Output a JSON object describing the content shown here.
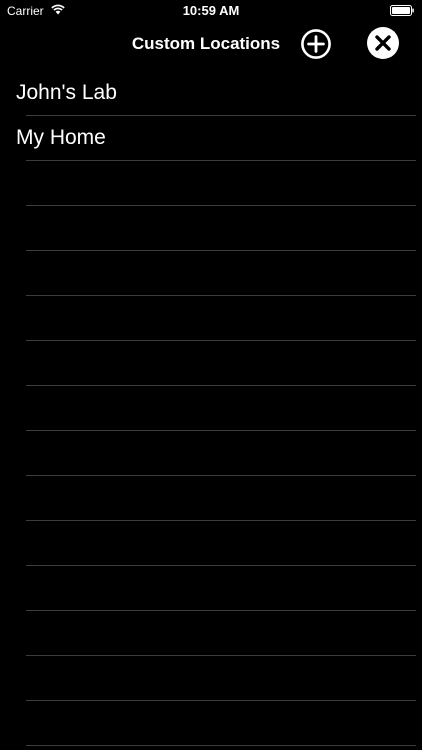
{
  "status_bar": {
    "carrier": "Carrier",
    "time": "10:59 AM",
    "wifi_icon": "wifi-icon",
    "battery_icon": "battery-icon"
  },
  "nav_bar": {
    "title": "Custom Locations",
    "add_icon": "plus-circle-icon",
    "close_icon": "close-circle-icon"
  },
  "locations": [
    {
      "label": "John's Lab"
    },
    {
      "label": "My Home"
    }
  ],
  "empty_row_count": 13,
  "colors": {
    "background": "#000000",
    "text": "#ffffff",
    "separator": "#3c3c3e"
  }
}
